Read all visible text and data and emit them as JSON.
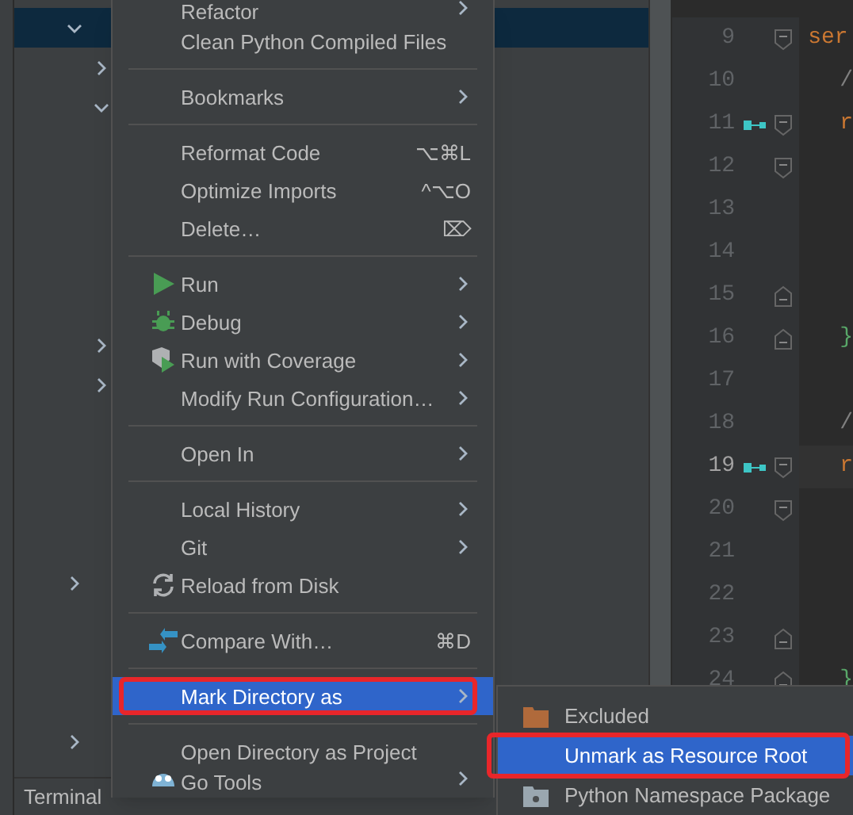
{
  "tree": {
    "rows": [
      {
        "kind": "folder",
        "expanded": true,
        "selected": true,
        "children": [
          {
            "kind": "folder",
            "expanded": false,
            "selected": false
          },
          {
            "kind": "folder",
            "expanded": true,
            "selected": false,
            "children": [
              {
                "selected": false
              },
              {
                "selected": false
              },
              {
                "selected": false
              },
              {
                "selected": false
              },
              {
                "selected": false
              }
            ]
          },
          {
            "kind": "folder",
            "expanded": false,
            "selected": false
          },
          {
            "kind": "folder",
            "expanded": false,
            "selected": false
          },
          {
            "kind": "file",
            "selected": false
          },
          {
            "kind": "file",
            "selected": false
          },
          {
            "kind": "file",
            "selected": false
          },
          {
            "kind": "file",
            "selected": false
          }
        ]
      },
      {
        "kind": "folder",
        "expanded": false,
        "selected": false
      },
      {
        "kind": "file",
        "selected": false
      },
      {
        "kind": "file",
        "selected": false
      },
      {
        "kind": "file",
        "selected": false
      },
      {
        "kind": "folder",
        "expanded": false,
        "selected": false
      }
    ]
  },
  "bottom_tab": "Terminal",
  "editor": {
    "lines": [
      {
        "number": "9",
        "text": "ser",
        "kind": "keyword",
        "indented": false,
        "fold_start": true,
        "fold_end": false,
        "gutter_icon": false,
        "current": false
      },
      {
        "number": "10",
        "text": "/",
        "kind": "comment",
        "indented": true,
        "fold_start": false,
        "fold_end": false,
        "gutter_icon": false,
        "current": false
      },
      {
        "number": "11",
        "text": "r",
        "kind": "keyword",
        "indented": true,
        "fold_start": true,
        "fold_end": false,
        "gutter_icon": true,
        "current": false
      },
      {
        "number": "12",
        "kind": "blank",
        "fold_start": true,
        "fold_end": false,
        "gutter_icon": false,
        "current": false
      },
      {
        "number": "13",
        "kind": "blank",
        "fold_start": false,
        "fold_end": false,
        "gutter_icon": false,
        "current": false
      },
      {
        "number": "14",
        "kind": "blank",
        "fold_start": false,
        "fold_end": false,
        "gutter_icon": false,
        "current": false
      },
      {
        "number": "15",
        "kind": "blank",
        "fold_start": false,
        "fold_end": true,
        "gutter_icon": false,
        "current": false
      },
      {
        "number": "16",
        "text": "}",
        "kind": "brace",
        "indented": true,
        "fold_start": false,
        "fold_end": true,
        "gutter_icon": false,
        "current": false
      },
      {
        "number": "17",
        "kind": "blank",
        "fold_start": false,
        "fold_end": false,
        "gutter_icon": false,
        "current": false
      },
      {
        "number": "18",
        "text": "/",
        "kind": "comment",
        "indented": true,
        "fold_start": false,
        "fold_end": false,
        "gutter_icon": false,
        "current": false
      },
      {
        "number": "19",
        "text": "r",
        "kind": "keyword",
        "indented": true,
        "fold_start": true,
        "fold_end": false,
        "gutter_icon": true,
        "current": true
      },
      {
        "number": "20",
        "kind": "blank",
        "fold_start": true,
        "fold_end": false,
        "gutter_icon": false,
        "current": false
      },
      {
        "number": "21",
        "kind": "blank",
        "fold_start": false,
        "fold_end": false,
        "gutter_icon": false,
        "current": false
      },
      {
        "number": "22",
        "kind": "blank",
        "fold_start": false,
        "fold_end": false,
        "gutter_icon": false,
        "current": false
      },
      {
        "number": "23",
        "kind": "blank",
        "fold_start": false,
        "fold_end": true,
        "gutter_icon": false,
        "current": false
      },
      {
        "number": "24",
        "text": "}",
        "kind": "brace",
        "indented": true,
        "fold_start": false,
        "fold_end": true,
        "gutter_icon": false,
        "current": false
      }
    ]
  },
  "context_menu": {
    "items": [
      {
        "kind": "plain",
        "label": "Refactor",
        "submenu": true,
        "selected": false
      },
      {
        "kind": "plain",
        "label": "Clean Python Compiled Files",
        "submenu": false,
        "selected": false
      },
      {
        "kind": "separator"
      },
      {
        "kind": "plain",
        "label": "Bookmarks",
        "submenu": true,
        "selected": false
      },
      {
        "kind": "separator"
      },
      {
        "kind": "plain",
        "label": "Reformat Code",
        "shortcut": "⌥⌘L",
        "submenu": false,
        "selected": false
      },
      {
        "kind": "plain",
        "label": "Optimize Imports",
        "shortcut": "^⌥O",
        "submenu": false,
        "selected": false
      },
      {
        "kind": "plain",
        "label": "Delete…",
        "shortcut": "⌦",
        "submenu": false,
        "selected": false
      },
      {
        "kind": "separator"
      },
      {
        "kind": "run",
        "label": "Run",
        "submenu": true,
        "selected": false
      },
      {
        "kind": "debug",
        "label": "Debug",
        "submenu": true,
        "selected": false
      },
      {
        "kind": "coverage",
        "label": "Run with Coverage",
        "submenu": true,
        "selected": false
      },
      {
        "kind": "plain",
        "label": "Modify Run Configuration…",
        "submenu": true,
        "selected": false
      },
      {
        "kind": "separator"
      },
      {
        "kind": "plain",
        "label": "Open In",
        "submenu": true,
        "selected": false
      },
      {
        "kind": "separator"
      },
      {
        "kind": "plain",
        "label": "Local History",
        "submenu": true,
        "selected": false
      },
      {
        "kind": "plain",
        "label": "Git",
        "submenu": true,
        "selected": false
      },
      {
        "kind": "reload",
        "label": "Reload from Disk",
        "submenu": false,
        "selected": false
      },
      {
        "kind": "separator"
      },
      {
        "kind": "compare",
        "label": "Compare With…",
        "shortcut": "⌘D",
        "submenu": false,
        "selected": false
      },
      {
        "kind": "separator"
      },
      {
        "kind": "plain",
        "label": "Mark Directory as",
        "submenu": true,
        "selected": true,
        "outlined": true
      },
      {
        "kind": "separator"
      },
      {
        "kind": "plain",
        "label": "Open Directory as Project",
        "submenu": false,
        "selected": false
      },
      {
        "kind": "gopher",
        "label": "Go Tools",
        "submenu": true,
        "selected": false
      }
    ]
  },
  "submenu": {
    "items": [
      {
        "kind": "excluded",
        "label": "Excluded",
        "selected": false,
        "outlined": false
      },
      {
        "kind": "plain",
        "label": "Unmark as Resource Root",
        "selected": true,
        "outlined": true
      },
      {
        "kind": "namespace",
        "label": "Python Namespace Package",
        "selected": false,
        "outlined": false
      }
    ]
  }
}
